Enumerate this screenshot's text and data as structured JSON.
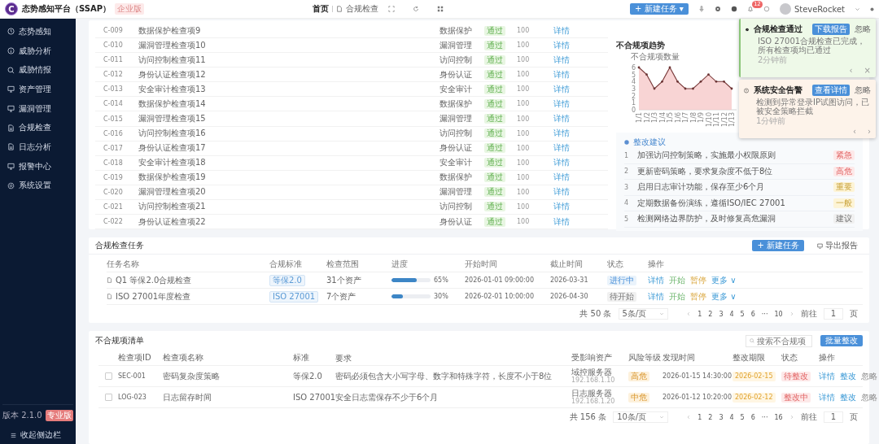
{
  "header": {
    "logo_letter": "C",
    "title": "态势感知平台（SSAP）",
    "edition": "企业版",
    "breadcrumb": [
      "首页",
      "合规检查"
    ],
    "new_button": "+ 新建任务 ▾",
    "notification_count": "12",
    "user": "SteveRocket"
  },
  "sidebar": {
    "items": [
      {
        "label": "态势感知",
        "selected": false
      },
      {
        "label": "威胁分析",
        "selected": false
      },
      {
        "label": "威胁情报",
        "selected": false
      },
      {
        "label": "资产管理",
        "selected": false
      },
      {
        "label": "漏洞管理",
        "selected": false
      },
      {
        "label": "合规检查",
        "selected": false
      },
      {
        "label": "日志分析",
        "selected": false
      },
      {
        "label": "报警中心",
        "selected": false
      },
      {
        "label": "系统设置",
        "selected": false
      }
    ],
    "version": "版本 2.1.0",
    "plan": "专业版",
    "collapse": "收起侧边栏"
  },
  "check_items": [
    {
      "id": "C-009",
      "name": "数据保护检查项9",
      "category": "数据保护",
      "status": "通过",
      "kind": "pass",
      "score": "100",
      "action": "详情"
    },
    {
      "id": "C-010",
      "name": "漏洞管理检查项10",
      "category": "漏洞管理",
      "status": "通过",
      "kind": "pass",
      "score": "100",
      "action": "详情"
    },
    {
      "id": "C-011",
      "name": "访问控制检查项11",
      "category": "访问控制",
      "status": "通过",
      "kind": "pass",
      "score": "100",
      "action": "详情"
    },
    {
      "id": "C-012",
      "name": "身份认证检查项12",
      "category": "身份认证",
      "status": "通过",
      "kind": "pass",
      "score": "100",
      "action": "详情"
    },
    {
      "id": "C-013",
      "name": "安全审计检查项13",
      "category": "安全审计",
      "status": "通过",
      "kind": "pass",
      "score": "100",
      "action": "详情"
    },
    {
      "id": "C-014",
      "name": "数据保护检查项14",
      "category": "数据保护",
      "status": "通过",
      "kind": "pass",
      "score": "100",
      "action": "详情"
    },
    {
      "id": "C-015",
      "name": "漏洞管理检查项15",
      "category": "漏洞管理",
      "status": "通过",
      "kind": "pass",
      "score": "100",
      "action": "详情"
    },
    {
      "id": "C-016",
      "name": "访问控制检查项16",
      "category": "访问控制",
      "status": "通过",
      "kind": "pass",
      "score": "100",
      "action": "详情"
    },
    {
      "id": "C-017",
      "name": "身份认证检查项17",
      "category": "身份认证",
      "status": "通过",
      "kind": "pass",
      "score": "100",
      "action": "详情"
    },
    {
      "id": "C-018",
      "name": "安全审计检查项18",
      "category": "安全审计",
      "status": "通过",
      "kind": "pass",
      "score": "100",
      "action": "详情"
    },
    {
      "id": "C-019",
      "name": "数据保护检查项19",
      "category": "数据保护",
      "status": "通过",
      "kind": "pass",
      "score": "100",
      "action": "详情"
    },
    {
      "id": "C-020",
      "name": "漏洞管理检查项20",
      "category": "漏洞管理",
      "status": "通过",
      "kind": "pass",
      "score": "100",
      "action": "详情"
    },
    {
      "id": "C-021",
      "name": "访问控制检查项21",
      "category": "访问控制",
      "status": "通过",
      "kind": "pass",
      "score": "100",
      "action": "详情"
    },
    {
      "id": "C-022",
      "name": "身份认证检查项22",
      "category": "身份认证",
      "status": "通过",
      "kind": "pass",
      "score": "100",
      "action": "详情"
    }
  ],
  "trend": {
    "title": "不合规项趋势",
    "chart_data": {
      "type": "area",
      "ylabel": "不合规项数量",
      "values": [
        6,
        5,
        3,
        4,
        6,
        4,
        3,
        3,
        4,
        5,
        4,
        4,
        3
      ],
      "yticks": [
        0,
        1,
        2,
        3,
        4,
        5,
        6
      ],
      "ylim": [
        0,
        6
      ],
      "categories": [
        "1/1",
        "1/2",
        "1/3",
        "1/4",
        "1/5",
        "1/6",
        "1/7",
        "1/8",
        "1/9",
        "1/10",
        "1/11",
        "1/12",
        "1/13"
      ]
    }
  },
  "suggestions": {
    "title": "整改建议",
    "items": [
      {
        "index": "1",
        "text": "加强访问控制策略，实施最小权限原则",
        "tag": "紧急",
        "kind": "urgent"
      },
      {
        "index": "2",
        "text": "更新密码策略，要求复杂度不低于8位",
        "tag": "高危",
        "kind": "high"
      },
      {
        "index": "3",
        "text": "启用日志审计功能，保存至少6个月",
        "tag": "重要",
        "kind": "important"
      },
      {
        "index": "4",
        "text": "定期数据备份演练，遵循ISO/IEC 27001",
        "tag": "一般",
        "kind": "normal"
      },
      {
        "index": "5",
        "text": "检测网络边界防护，及时修复高危漏洞",
        "tag": "建议",
        "kind": "suggest"
      }
    ]
  },
  "toasts": [
    {
      "kind": "success",
      "title": "合规检查通过",
      "message": "ISO 27001合规检查已完成，所有检查项均已通过",
      "time": "2分钟前",
      "action": "下载报告",
      "dismiss": "忽略",
      "nav": [
        "‹",
        "×"
      ]
    },
    {
      "kind": "warning",
      "title": "系统安全告警",
      "message": "检测到异常登录IP试图访问，已被安全策略拦截",
      "time": "1分钟前",
      "action": "查看详情",
      "dismiss": "忽略",
      "nav": [
        "‹",
        "›"
      ]
    }
  ],
  "tasks": {
    "title": "合规检查任务",
    "new_button": "+ 新建任务",
    "export_button": "导出报告",
    "columns": [
      "任务名称",
      "合规标准",
      "检查范围",
      "进度",
      "开始时间",
      "截止时间",
      "状态",
      "操作"
    ],
    "rows": [
      {
        "name": "Q1 等保2.0合规检查",
        "standard": "等保2.0",
        "scope": "31个资产",
        "level": 0.65,
        "percent": "65%",
        "start": "2026-01-01 09:00:00",
        "end": "2026-03-31",
        "status": "进行中",
        "kind": "running",
        "actions": [
          "详情",
          "开始",
          "暂停",
          "更多 ∨"
        ]
      },
      {
        "name": "ISO 27001年度检查",
        "standard": "ISO 27001",
        "scope": "7个资产",
        "level": 0.3,
        "percent": "30%",
        "start": "2026-02-01 10:00:00",
        "end": "2026-04-30",
        "status": "待开始",
        "kind": "pending",
        "actions": [
          "详情",
          "开始",
          "暂停",
          "更多 ∨"
        ]
      }
    ],
    "pagination": {
      "total": "共 50 条",
      "size": "5条/页",
      "pages": [
        "1",
        "2",
        "3",
        "4",
        "5",
        "6",
        "···",
        "10"
      ],
      "goto": "前往",
      "page": "1",
      "unit": "页"
    }
  },
  "issues": {
    "title": "不合规项清单",
    "search_placeholder": "搜索不合规项",
    "batch_button": "批量整改",
    "columns": [
      "检查项ID",
      "检查项名称",
      "标准",
      "要求",
      "受影响资产",
      "风险等级",
      "发现时间",
      "整改期限",
      "状态",
      "操作"
    ],
    "rows": [
      {
        "checked": false,
        "id": "SEC-001",
        "name": "密码复杂度策略",
        "standard": "等保2.0",
        "requirement": "密码必须包含大小写字母、数字和特殊字符，长度不小于8位",
        "asset": "域控服务器",
        "ip": "192.168.1.10",
        "risk": "高危",
        "found": "2026-01-15 14:30:00",
        "deadline": "2026-02-15",
        "status": "待整改",
        "actions": [
          "详情",
          "整改",
          "忽略"
        ]
      },
      {
        "checked": false,
        "id": "LOG-023",
        "name": "日志留存时间",
        "standard": "ISO 27001",
        "requirement": "安全日志需保存不少于6个月",
        "asset": "日志服务器",
        "ip": "192.168.1.20",
        "risk": "中危",
        "found": "2026-01-12 10:20:00",
        "deadline": "2026-02-12",
        "status": "整改中",
        "actions": [
          "详情",
          "整改",
          "忽略"
        ]
      }
    ],
    "pagination": {
      "total": "共 156 条",
      "size": "10条/页",
      "pages": [
        "1",
        "2",
        "3",
        "4",
        "5",
        "6",
        "···",
        "16"
      ],
      "goto": "前往",
      "page": "1",
      "unit": "页"
    }
  }
}
